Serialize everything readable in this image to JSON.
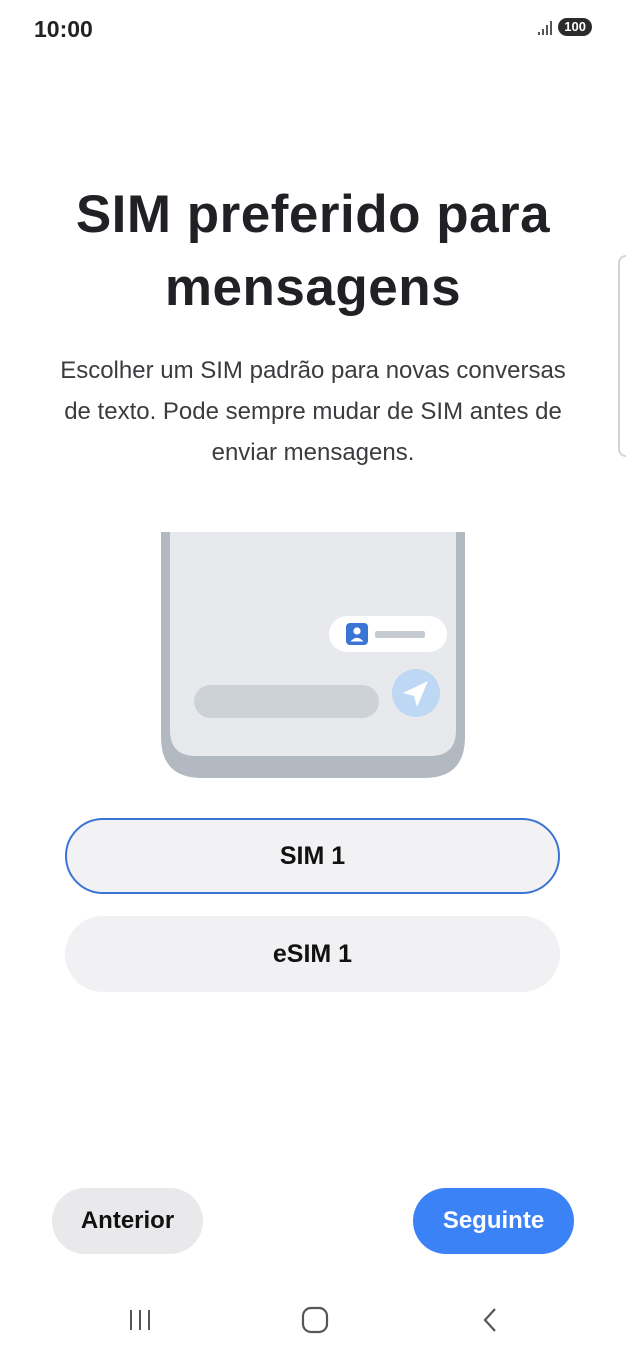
{
  "status_bar": {
    "time": "10:00",
    "battery": "100"
  },
  "setup": {
    "title_line1": "SIM preferido para",
    "title_line2": "mensagens",
    "description": "Escolher um SIM padrão para novas conversas de texto. Pode sempre mudar de SIM antes de enviar mensagens."
  },
  "options": {
    "sim1": {
      "label": "SIM 1",
      "selected": true
    },
    "esim1": {
      "label": "eSIM 1",
      "selected": false
    }
  },
  "buttons": {
    "previous": "Anterior",
    "next": "Seguinte"
  },
  "colors": {
    "accent": "#3b82f6",
    "selected_border": "#3a74d4",
    "option_bg": "#f1f1f3"
  },
  "nav_icons": [
    "recents-icon",
    "home-icon",
    "back-icon"
  ]
}
